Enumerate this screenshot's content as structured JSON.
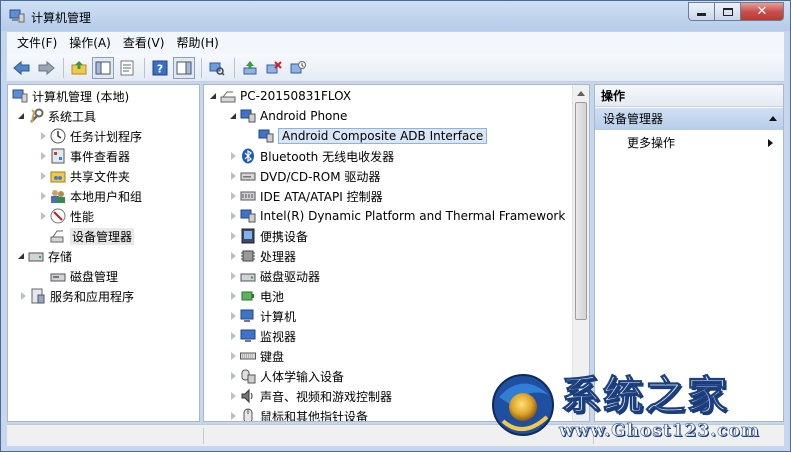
{
  "window": {
    "title": "计算机管理"
  },
  "menu": [
    "文件(F)",
    "操作(A)",
    "查看(V)",
    "帮助(H)"
  ],
  "toolbar": {
    "icons": [
      "back-arrow-icon",
      "forward-arrow-icon",
      "up-folder-icon",
      "console-tree-icon",
      "properties-icon",
      "help-icon",
      "action-pane-icon",
      "scan-hardware-icon",
      "update-driver-icon",
      "uninstall-icon",
      "disable-device-icon"
    ]
  },
  "left_tree": [
    {
      "label": "计算机管理 (本地)",
      "icon": "computer-management-icon"
    },
    {
      "label": "系统工具",
      "icon": "tools-icon"
    },
    {
      "label": "任务计划程序",
      "icon": "clock-icon"
    },
    {
      "label": "事件查看器",
      "icon": "event-viewer-icon"
    },
    {
      "label": "共享文件夹",
      "icon": "shared-folder-icon"
    },
    {
      "label": "本地用户和组",
      "icon": "users-icon"
    },
    {
      "label": "性能",
      "icon": "performance-icon"
    },
    {
      "label": "设备管理器",
      "icon": "device-manager-icon"
    },
    {
      "label": "存储",
      "icon": "storage-icon"
    },
    {
      "label": "磁盘管理",
      "icon": "disk-icon"
    },
    {
      "label": "服务和应用程序",
      "icon": "services-icon"
    }
  ],
  "device_tree": {
    "root": "PC-20150831FLOX",
    "items": [
      "Android Phone",
      "Android Composite ADB Interface",
      "Bluetooth 无线电收发器",
      "DVD/CD-ROM 驱动器",
      "IDE ATA/ATAPI 控制器",
      "Intel(R) Dynamic Platform and Thermal Framework",
      "便携设备",
      "处理器",
      "磁盘驱动器",
      "电池",
      "计算机",
      "监视器",
      "键盘",
      "人体学输入设备",
      "声音、视频和游戏控制器",
      "鼠标和其他指针设备"
    ]
  },
  "actions": {
    "header": "操作",
    "section": "设备管理器",
    "more": "更多操作"
  },
  "watermark": {
    "brand": "系统之家",
    "url": "www.Ghost123.com"
  }
}
